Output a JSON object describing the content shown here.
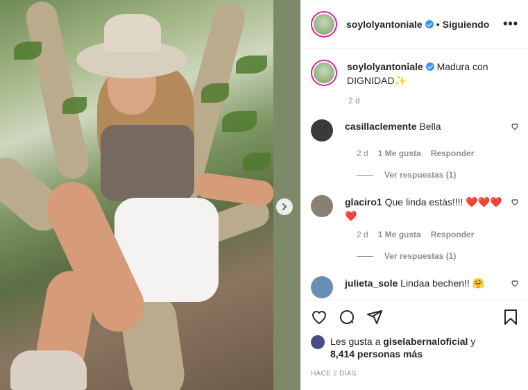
{
  "post": {
    "username": "soylolyantoniale",
    "follow_status": "Siguiendo",
    "dot": "•",
    "more": "•••",
    "caption_text": "Madura con DIGNIDAD",
    "caption_emoji": "✨",
    "caption_time": "2 d"
  },
  "comments": [
    {
      "username": "casillaclemente",
      "text": "Bella",
      "time": "2 d",
      "likes": "1 Me gusta",
      "reply": "Responder",
      "view_replies": "Ver respuestas (1)",
      "avatar_color": "#3b3a3a"
    },
    {
      "username": "glaciro1",
      "text": "Que linda estás!!!!",
      "emoji": "❤️❤️❤️❤️",
      "time": "2 d",
      "likes": "1 Me gusta",
      "reply": "Responder",
      "view_replies": "Ver respuestas (1)",
      "avatar_color": "#8a7f74"
    },
    {
      "username": "julieta_sole",
      "text": "Lindaa bechen!!",
      "emoji": "🤗",
      "avatar_color": "#6a8fb5"
    }
  ],
  "likes_info": {
    "prefix": "Les gusta a",
    "user": "giselabernaloficial",
    "conjunction": "y",
    "others": "8,414 personas más",
    "avatar_color": "#4b4b8a"
  },
  "time_ago": "HACE 2 DÍAS",
  "colors": {
    "verified": "#3897f0",
    "heart": "#ed4956",
    "muted": "#8e8e8e",
    "story_ring": "#d6249f"
  }
}
